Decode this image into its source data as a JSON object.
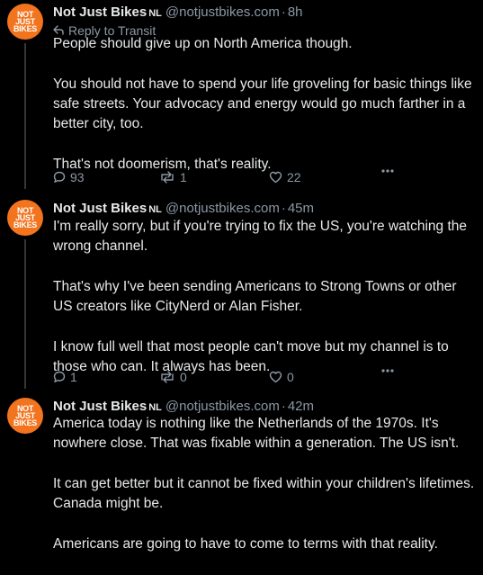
{
  "posts": [
    {
      "avatar_text": [
        "NOT",
        "JUST",
        "BIKES"
      ],
      "author": "Not Just Bikes",
      "nl": "NL",
      "handle": "@notjustbikes.com",
      "dot": "·",
      "time": "8h",
      "reply_to": "Reply to Transit",
      "paragraphs": [
        "People should give up on North America though.",
        "You should not have to spend your life groveling for basic things like safe streets. Your advocacy and energy would go much farther in a better city, too.",
        "That's not doomerism, that's reality."
      ],
      "replies": "93",
      "reposts": "1",
      "likes": "22"
    },
    {
      "avatar_text": [
        "NOT",
        "JUST",
        "BIKES"
      ],
      "author": "Not Just Bikes",
      "nl": "NL",
      "handle": "@notjustbikes.com",
      "dot": "·",
      "time": "45m",
      "paragraphs": [
        "I'm really sorry, but if you're trying to fix the US, you're watching the wrong channel.",
        "That's why I've been sending Americans to Strong Towns or other US creators like CityNerd or Alan Fisher.",
        "I know full well that most people can't move but my channel is to those who can. It always has been."
      ],
      "replies": "1",
      "reposts": "0",
      "likes": "0"
    },
    {
      "avatar_text": [
        "NOT",
        "JUST",
        "BIKES"
      ],
      "author": "Not Just Bikes",
      "nl": "NL",
      "handle": "@notjustbikes.com",
      "dot": "·",
      "time": "42m",
      "paragraphs": [
        "America today is nothing like the Netherlands of the 1970s. It's nowhere close. That was fixable within a generation. The US isn't.",
        "It can get better but it cannot be fixed within your children's lifetimes. Canada might be.",
        "Americans are going to have to come to terms with that reality."
      ]
    }
  ],
  "colors": {
    "background": "#000000",
    "text": "#e7e9ea",
    "muted": "#8b98a5",
    "avatar": "#f2741f",
    "thread_line": "#333639"
  },
  "icons": {
    "reply": "speech-bubble-icon",
    "repost": "repost-arrows-icon",
    "like": "heart-icon",
    "more": "ellipsis-icon",
    "reply_to": "reply-arrow-icon"
  }
}
